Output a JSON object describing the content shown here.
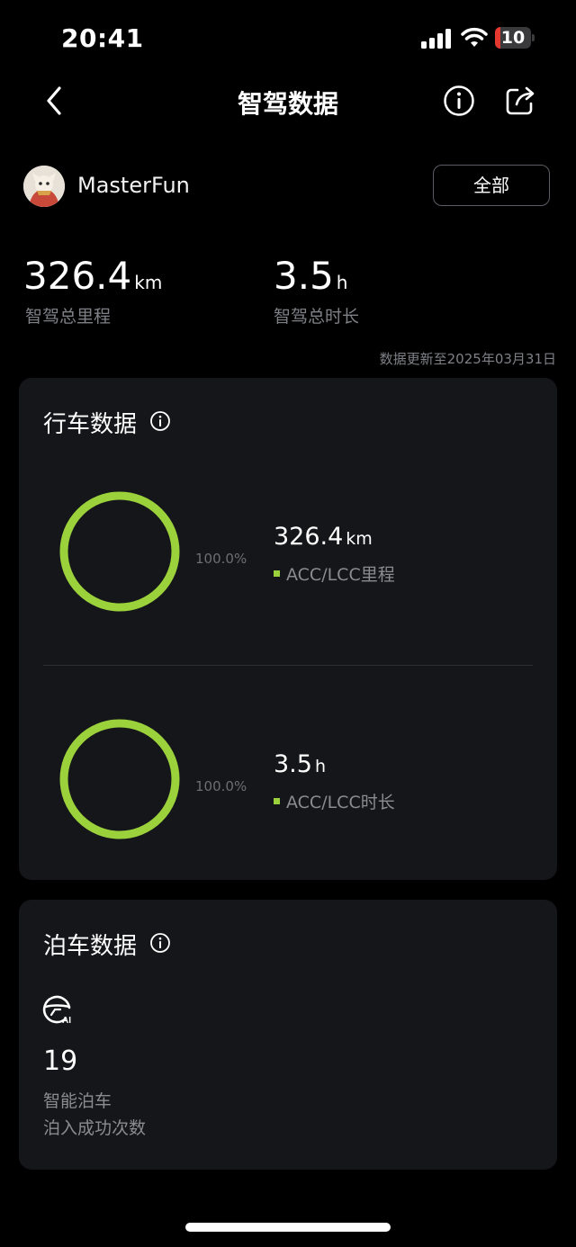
{
  "status_bar": {
    "time": "20:41",
    "battery": "10"
  },
  "nav": {
    "title": "智驾数据"
  },
  "profile": {
    "username": "MasterFun",
    "filter_label": "全部"
  },
  "totals": {
    "distance": {
      "value": "326.4",
      "unit": "km",
      "label": "智驾总里程"
    },
    "duration": {
      "value": "3.5",
      "unit": "h",
      "label": "智驾总时长"
    }
  },
  "update_note": "数据更新至2025年03月31日",
  "driving": {
    "title": "行车数据",
    "metrics": [
      {
        "percent_label": "100.0%",
        "value": "326.4",
        "unit": "km",
        "label": "ACC/LCC里程",
        "fraction": 1.0
      },
      {
        "percent_label": "100.0%",
        "value": "3.5",
        "unit": "h",
        "label": "ACC/LCC时长",
        "fraction": 1.0
      }
    ]
  },
  "parking": {
    "title": "泊车数据",
    "icon": "ai-parking-icon",
    "count": "19",
    "label_line1": "智能泊车",
    "label_line2": "泊入成功次数"
  },
  "colors": {
    "accent": "#9bd13b",
    "card": "#151619",
    "background": "#000000"
  }
}
